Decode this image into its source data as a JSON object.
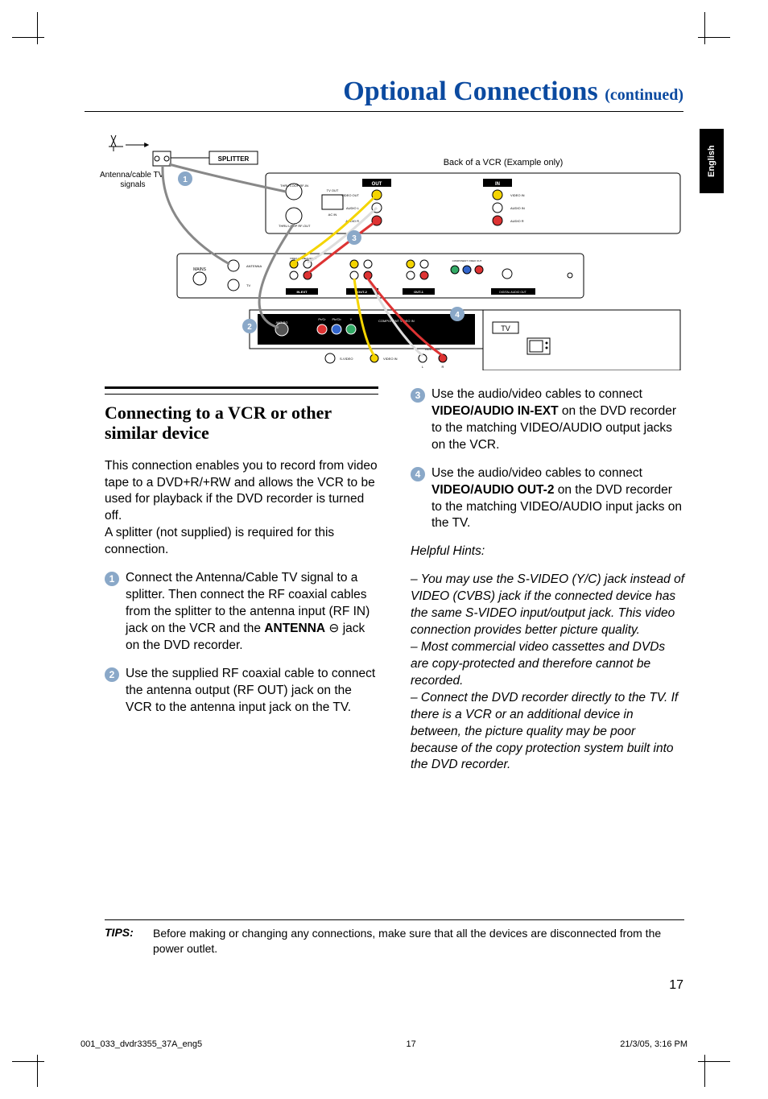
{
  "language_tab": "English",
  "title_main": "Optional Connections",
  "title_cont": "(continued)",
  "diagram": {
    "antenna_label": "Antenna/cable TV signals",
    "splitter_label": "SPLITTER",
    "vcr_back_label": "Back of a VCR (Example only)",
    "tv_label": "TV",
    "vcr_ports": {
      "thru_rf_in": "THRU LOOP RF-IN",
      "thru_rf_out": "THRU LOOP RF-OUT",
      "tv_out": "TV OUT",
      "ac_in": "AC IN",
      "out_header": "OUT",
      "in_header": "IN",
      "video_out": "VIDEO OUT",
      "audio_l": "AUDIO L",
      "audio_r": "AUDIO R",
      "video_in": "VIDEO IN",
      "audio_in": "AUDIO IN",
      "audio_r2": "AUDIO R"
    },
    "dvdr_ports": {
      "mains": "MAINS",
      "antenna": "ANTENNA",
      "tv": "TV",
      "video_cvbs": "VIDEO (CVBS)",
      "s_video_yc": "S-VIDEO (Y/C)",
      "l_audio_r": "L-AUDIO-R",
      "in_ext": "IN-EXT",
      "out2": "OUT-2",
      "out1": "OUT-1",
      "digital_audio_out": "DIGITAL AUDIO OUT",
      "pb": "Pb",
      "pr": "Pr",
      "y": "Y",
      "component_video_out": "COMPONENT VIDEO OUT",
      "coaxial": "COAXIAL"
    },
    "tv_ports": {
      "ant_rg": "ANT RG",
      "pr_cr": "Pr/Cr",
      "pb_cb": "Pb/Cb",
      "y": "Y",
      "component_video_in": "COMPONENT VIDEO IN",
      "s_video": "S-VIDEO",
      "video_in": "VIDEO IN",
      "audio_in": "AUDIO IN",
      "l": "L",
      "r": "R"
    },
    "callouts": {
      "c1": "1",
      "c2": "2",
      "c3": "3",
      "c4": "4"
    }
  },
  "section_title": "Connecting to a VCR or other similar device",
  "intro_p1": "This connection enables you to record from video tape to a DVD+R/+RW and allows the VCR to be used for playback if the DVD recorder is turned off.",
  "intro_p2": "A splitter (not supplied) is required for this connection.",
  "step1_a": "Connect the Antenna/Cable TV signal to a splitter.  Then connect the RF coaxial cables from the splitter to the antenna input (RF IN) jack on the VCR and the ",
  "step1_bold": "ANTENNA",
  "step1_b": " jack on the DVD recorder.",
  "step2": "Use the supplied RF coaxial cable to connect the antenna output (RF OUT) jack on the VCR to the antenna input jack on the TV.",
  "step3_a": "Use the audio/video cables to connect ",
  "step3_bold": "VIDEO/AUDIO IN-EXT",
  "step3_b": " on the DVD recorder to the matching VIDEO/AUDIO output jacks on the VCR.",
  "step4_a": "Use the audio/video cables to connect ",
  "step4_bold": "VIDEO/AUDIO OUT-2",
  "step4_b": " on the DVD recorder to the matching VIDEO/AUDIO input jacks on the TV.",
  "hints_head": "Helpful Hints:",
  "hint1": "–  You may use the S-VIDEO (Y/C) jack instead of VIDEO (CVBS) jack if the connected device has the same S-VIDEO input/output jack.  This video connection provides better picture quality.",
  "hint2": "–   Most commercial video cassettes and DVDs are copy-protected and therefore cannot be recorded.",
  "hint3": "–  Connect the DVD recorder directly to the TV.  If there is a VCR or an additional device in between, the picture quality may be poor because of the copy protection system built into the DVD recorder.",
  "tips_label": "TIPS:",
  "tips_text": "Before making or changing any connections, make sure that all the devices are disconnected from the power outlet.",
  "page_number": "17",
  "footer_left": "001_033_dvdr3355_37A_eng5",
  "footer_center": "17",
  "footer_right": "21/3/05, 3:16 PM"
}
